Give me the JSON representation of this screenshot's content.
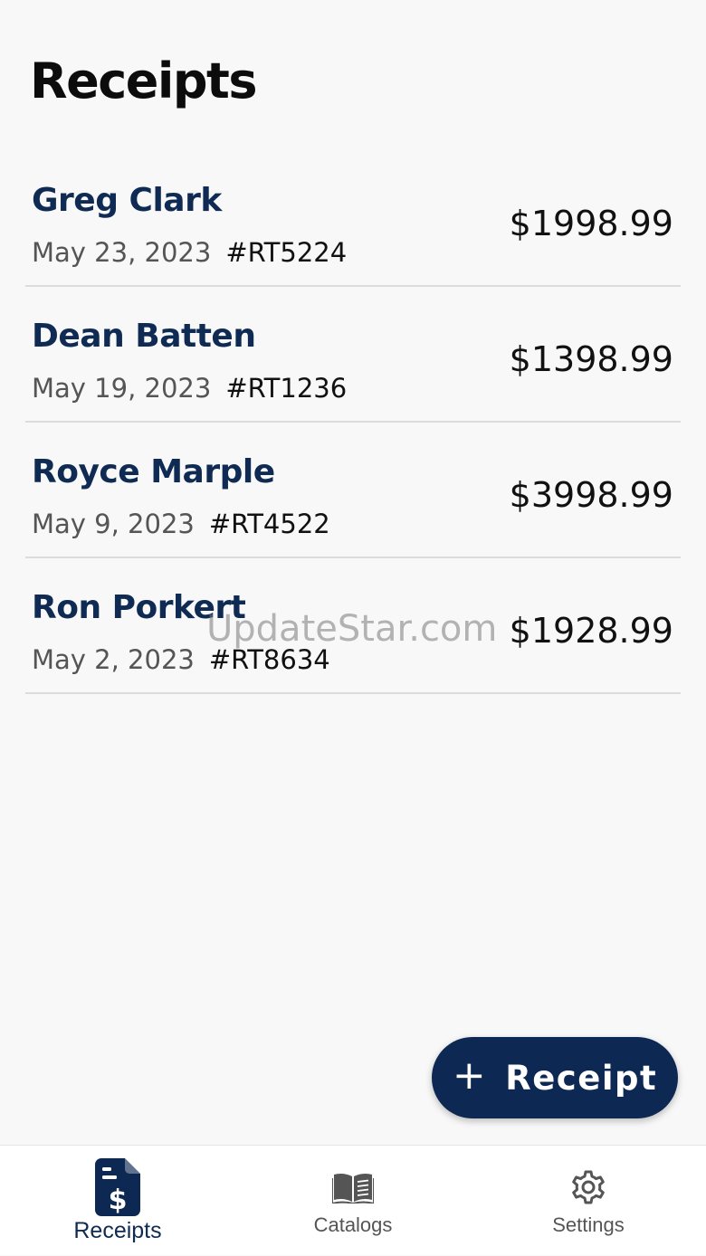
{
  "header": {
    "title": "Receipts"
  },
  "receipts": [
    {
      "name": "Greg Clark",
      "date": "May 23, 2023",
      "number": "#RT5224",
      "amount": "$1998.99"
    },
    {
      "name": "Dean Batten",
      "date": "May 19, 2023",
      "number": "#RT1236",
      "amount": "$1398.99"
    },
    {
      "name": "Royce Marple",
      "date": "May 9, 2023",
      "number": "#RT4522",
      "amount": "$3998.99"
    },
    {
      "name": "Ron Porkert",
      "date": "May 2, 2023",
      "number": "#RT8634",
      "amount": "$1928.99"
    }
  ],
  "watermark": "UpdateStar.com",
  "fab": {
    "label": "Receipt",
    "icon": "plus-icon"
  },
  "bottom_nav": {
    "items": [
      {
        "label": "Receipts",
        "icon": "receipt-dollar-icon",
        "active": true
      },
      {
        "label": "Catalogs",
        "icon": "book-icon",
        "active": false
      },
      {
        "label": "Settings",
        "icon": "gear-icon",
        "active": false
      }
    ]
  },
  "colors": {
    "primary": "#0d2852",
    "name_text": "#0f2b53",
    "background": "#f8f8f8",
    "divider": "#dcdcdc",
    "inactive_nav": "#555555"
  }
}
